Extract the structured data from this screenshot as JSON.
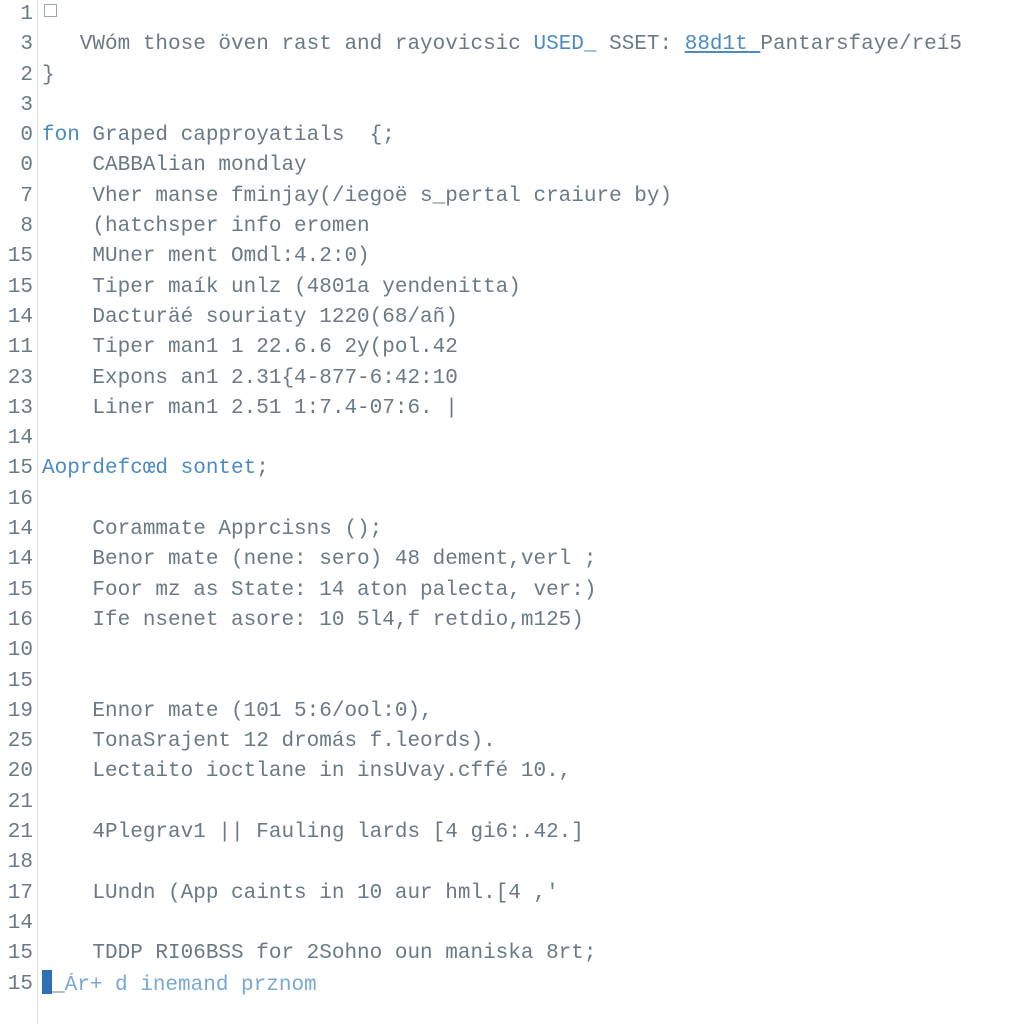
{
  "lines": [
    {
      "num": "1",
      "type": "collapse",
      "text": ""
    },
    {
      "num": "3",
      "type": "rich1",
      "prefix": "   VWóm those öven rast and rayovicsic ",
      "k1": "USED_",
      "mid1": " SSET: ",
      "linkText": "88d1t ",
      "tail": "Pantarsfaye/reí5"
    },
    {
      "num": "2",
      "type": "plain",
      "text": "}"
    },
    {
      "num": "3",
      "type": "plain",
      "text": ""
    },
    {
      "num": "0",
      "type": "rich2",
      "kwText": "fon ",
      "rest": "Graped capproyatials  {;"
    },
    {
      "num": "0",
      "type": "plain",
      "text": "    CABBAlian mondlay"
    },
    {
      "num": "7",
      "type": "plain",
      "text": "    Vher manse fminjay(/iegoë s_pertal craiure by)"
    },
    {
      "num": "8",
      "type": "plain",
      "text": "    (hatchsper info eromen"
    },
    {
      "num": "15",
      "type": "plain",
      "text": "    MUner ment Omdl:4.2:0)"
    },
    {
      "num": "15",
      "type": "plain",
      "text": "    Tiper maík unlz (4801a yendenitta)"
    },
    {
      "num": "14",
      "type": "plain",
      "text": "    Dacturäé souriaty 1220(68/añ)"
    },
    {
      "num": "11",
      "type": "plain",
      "text": "    Tiper man1 1 22.6.6 2y(pol.42"
    },
    {
      "num": "23",
      "type": "plain",
      "text": "    Expons an1 2.31{4-877-6:42:10"
    },
    {
      "num": "13",
      "type": "plain",
      "text": "    Liner man1 2.51 1:7.4-07:6. |"
    },
    {
      "num": "14",
      "type": "plain",
      "text": ""
    },
    {
      "num": "15",
      "type": "kwline",
      "kwText": "Aoprdefcœd sontet",
      "rest": ";"
    },
    {
      "num": "16",
      "type": "plain",
      "text": ""
    },
    {
      "num": "14",
      "type": "plain",
      "text": "    Corammate Apprcisns ();"
    },
    {
      "num": "14",
      "type": "plain",
      "text": "    Benor mate (nene: sero) 48 dement,verl ;"
    },
    {
      "num": "15",
      "type": "plain",
      "text": "    Foor mz as State: 14 aton palecta, ver:)"
    },
    {
      "num": "16",
      "type": "plain",
      "text": "    Ife nsenet asore: 10 5l4,f retdio,m125)"
    },
    {
      "num": "10",
      "type": "plain",
      "text": ""
    },
    {
      "num": "15",
      "type": "plain",
      "text": ""
    },
    {
      "num": "19",
      "type": "plain",
      "text": "    Ennor mate (101 5:6/ool:0),"
    },
    {
      "num": "25",
      "type": "plain",
      "text": "    TonaSrajent 12 dromás f.leords)."
    },
    {
      "num": "20",
      "type": "plain",
      "text": "    Lectaito ioctlane in insUvay.cffé 10.,"
    },
    {
      "num": "21",
      "type": "plain",
      "text": ""
    },
    {
      "num": "21",
      "type": "plain",
      "text": "    4Plegrav1 || Fauling lards [4 gi6:.42.]"
    },
    {
      "num": "18",
      "type": "plain",
      "text": ""
    },
    {
      "num": "17",
      "type": "plain",
      "text": "    LUndn (App caints in 10 aur hml.[4 ,'"
    },
    {
      "num": "14",
      "type": "plain",
      "text": ""
    },
    {
      "num": "15",
      "type": "plain",
      "text": "    TDDP RI06BSS for 2Sohno oun maniska 8rt;"
    },
    {
      "num": "15",
      "type": "cursor",
      "faintText": "Ár+ d inemand prznom"
    }
  ]
}
